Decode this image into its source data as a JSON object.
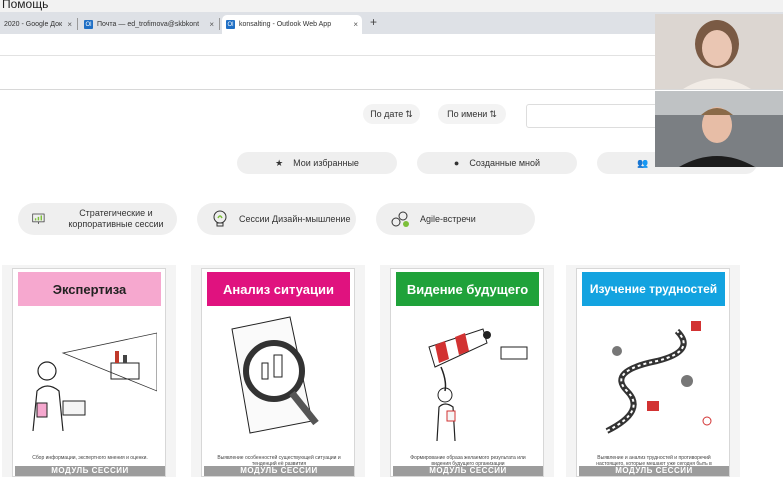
{
  "titlebar": {
    "menu": "Помощь"
  },
  "tabs": [
    {
      "label": "2020 - Google Док",
      "close": "×"
    },
    {
      "label": "Почта — ed_trofimova@skbkont",
      "close": "×",
      "icon": "Ol"
    },
    {
      "label": "konsalting - Outlook Web App",
      "close": "×",
      "icon": "Ol"
    }
  ],
  "new_tab": "+",
  "sort": {
    "by_date": "По дате",
    "by_name": "По имени",
    "sort_icon": "⇅"
  },
  "filters": [
    {
      "label": "Мои избранные",
      "icon": "★"
    },
    {
      "label": "Созданные мной",
      "icon": "●"
    },
    {
      "label": "",
      "icon": "👥"
    }
  ],
  "categories": [
    {
      "label": "Стратегические и корпоративные сессии"
    },
    {
      "label": "Сессии Дизайн-мышление"
    },
    {
      "label": "Agile-встречи"
    }
  ],
  "cards": [
    {
      "title": "Экспертиза",
      "color": "#f6a8cf",
      "text_color": "#222",
      "desc": "Сбор информации, экспертного мнения и оценки.",
      "footer": "МОДУЛЬ СЕССИИ"
    },
    {
      "title": "Анализ ситуации",
      "color": "#e0127f",
      "text_color": "#ffffff",
      "desc": "Выявление особенностей существующей ситуации и тенденций её развития",
      "footer": "МОДУЛЬ СЕССИИ"
    },
    {
      "title": "Видение будущего",
      "color": "#1fa23a",
      "text_color": "#ffffff",
      "desc": "Формирование образа желаемого результата или видения будущего организации",
      "footer": "МОДУЛЬ СЕССИИ"
    },
    {
      "title": "Изучение трудностей",
      "color": "#13a3e0",
      "text_color": "#ffffff",
      "desc": "Выявление и анализ трудностей и противоречий настоящего, которые мешают уже сегодня быть в «желаемом будущем».",
      "footer": "МОДУЛЬ СЕССИИ"
    }
  ],
  "colors": {
    "tab_bar": "#dee1e6",
    "pill": "#efefef",
    "footer": "#9c9c9c"
  }
}
